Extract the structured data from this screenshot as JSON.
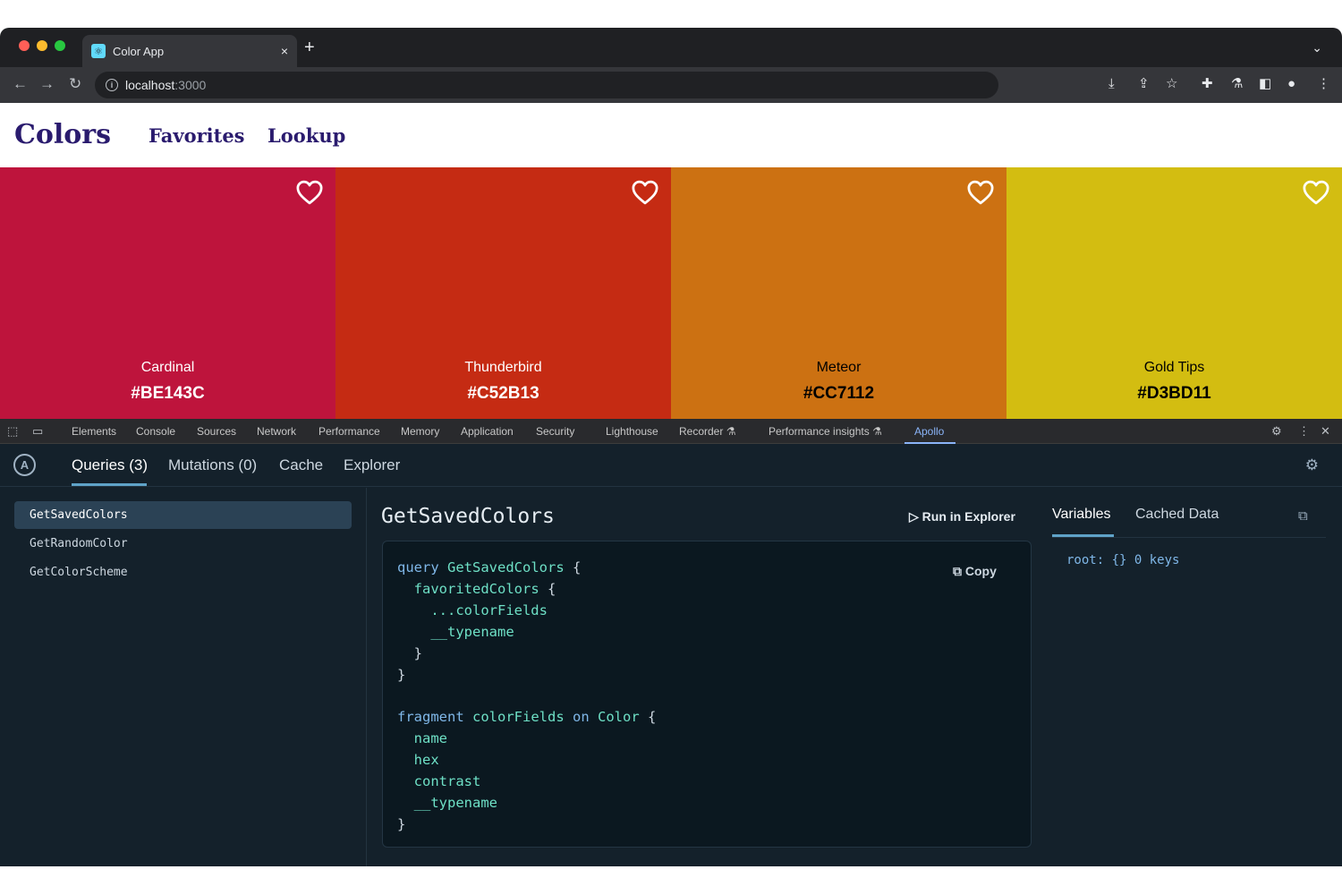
{
  "browser": {
    "tab_title": "Color App",
    "tab_close": "×",
    "new_tab": "+",
    "url_host": "localhost",
    "url_port": ":3000"
  },
  "app": {
    "brand": "Colors",
    "nav": [
      "Favorites",
      "Lookup"
    ]
  },
  "colors": [
    {
      "name": "Cardinal",
      "hex": "#BE143C",
      "text_color": "#ffffff"
    },
    {
      "name": "Thunderbird",
      "hex": "#C52B13",
      "text_color": "#ffffff"
    },
    {
      "name": "Meteor",
      "hex": "#CC7112",
      "text_color": "#000000"
    },
    {
      "name": "Gold Tips",
      "hex": "#D3BD11",
      "text_color": "#000000"
    }
  ],
  "devtools": {
    "tabs": [
      "Elements",
      "Console",
      "Sources",
      "Network",
      "Performance",
      "Memory",
      "Application",
      "Security",
      "Lighthouse",
      "Recorder",
      "Performance insights",
      "Apollo"
    ],
    "active_tab": "Apollo"
  },
  "apollo": {
    "tabs": [
      "Queries (3)",
      "Mutations (0)",
      "Cache",
      "Explorer"
    ],
    "active_tab": "Queries (3)",
    "queries": [
      "GetSavedColors",
      "GetRandomColor",
      "GetColorScheme"
    ],
    "selected_query": "GetSavedColors",
    "query_title": "GetSavedColors",
    "run_label": "Run in Explorer",
    "copy_label": "Copy",
    "code_lines": [
      "query GetSavedColors {",
      "  favoritedColors {",
      "    ...colorFields",
      "    __typename",
      "  }",
      "}",
      "",
      "fragment colorFields on Color {",
      "  name",
      "  hex",
      "  contrast",
      "  __typename",
      "}"
    ],
    "right_tabs": [
      "Variables",
      "Cached Data"
    ],
    "right_active": "Variables",
    "variables_text": "root: {} 0 keys"
  },
  "accent": "#5fa3c8"
}
